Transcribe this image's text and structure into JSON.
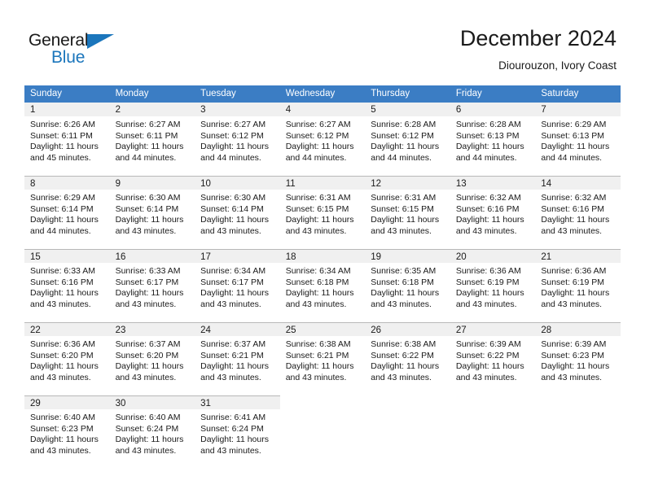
{
  "brand": {
    "name_top": "General",
    "name_bottom": "Blue",
    "accent_color": "#1b76bc"
  },
  "header": {
    "title": "December 2024",
    "subtitle": "Diourouzon, Ivory Coast"
  },
  "theme": {
    "header_row_bg": "#3b7dc4",
    "daynum_bg": "#f0f0f0",
    "text_color": "#1a1a1a",
    "grid_line": "#b8b8b8"
  },
  "weekday_headers": [
    "Sunday",
    "Monday",
    "Tuesday",
    "Wednesday",
    "Thursday",
    "Friday",
    "Saturday"
  ],
  "weeks": [
    [
      {
        "day": "1",
        "sunrise": "Sunrise: 6:26 AM",
        "sunset": "Sunset: 6:11 PM",
        "daylight1": "Daylight: 11 hours",
        "daylight2": "and 45 minutes."
      },
      {
        "day": "2",
        "sunrise": "Sunrise: 6:27 AM",
        "sunset": "Sunset: 6:11 PM",
        "daylight1": "Daylight: 11 hours",
        "daylight2": "and 44 minutes."
      },
      {
        "day": "3",
        "sunrise": "Sunrise: 6:27 AM",
        "sunset": "Sunset: 6:12 PM",
        "daylight1": "Daylight: 11 hours",
        "daylight2": "and 44 minutes."
      },
      {
        "day": "4",
        "sunrise": "Sunrise: 6:27 AM",
        "sunset": "Sunset: 6:12 PM",
        "daylight1": "Daylight: 11 hours",
        "daylight2": "and 44 minutes."
      },
      {
        "day": "5",
        "sunrise": "Sunrise: 6:28 AM",
        "sunset": "Sunset: 6:12 PM",
        "daylight1": "Daylight: 11 hours",
        "daylight2": "and 44 minutes."
      },
      {
        "day": "6",
        "sunrise": "Sunrise: 6:28 AM",
        "sunset": "Sunset: 6:13 PM",
        "daylight1": "Daylight: 11 hours",
        "daylight2": "and 44 minutes."
      },
      {
        "day": "7",
        "sunrise": "Sunrise: 6:29 AM",
        "sunset": "Sunset: 6:13 PM",
        "daylight1": "Daylight: 11 hours",
        "daylight2": "and 44 minutes."
      }
    ],
    [
      {
        "day": "8",
        "sunrise": "Sunrise: 6:29 AM",
        "sunset": "Sunset: 6:14 PM",
        "daylight1": "Daylight: 11 hours",
        "daylight2": "and 44 minutes."
      },
      {
        "day": "9",
        "sunrise": "Sunrise: 6:30 AM",
        "sunset": "Sunset: 6:14 PM",
        "daylight1": "Daylight: 11 hours",
        "daylight2": "and 43 minutes."
      },
      {
        "day": "10",
        "sunrise": "Sunrise: 6:30 AM",
        "sunset": "Sunset: 6:14 PM",
        "daylight1": "Daylight: 11 hours",
        "daylight2": "and 43 minutes."
      },
      {
        "day": "11",
        "sunrise": "Sunrise: 6:31 AM",
        "sunset": "Sunset: 6:15 PM",
        "daylight1": "Daylight: 11 hours",
        "daylight2": "and 43 minutes."
      },
      {
        "day": "12",
        "sunrise": "Sunrise: 6:31 AM",
        "sunset": "Sunset: 6:15 PM",
        "daylight1": "Daylight: 11 hours",
        "daylight2": "and 43 minutes."
      },
      {
        "day": "13",
        "sunrise": "Sunrise: 6:32 AM",
        "sunset": "Sunset: 6:16 PM",
        "daylight1": "Daylight: 11 hours",
        "daylight2": "and 43 minutes."
      },
      {
        "day": "14",
        "sunrise": "Sunrise: 6:32 AM",
        "sunset": "Sunset: 6:16 PM",
        "daylight1": "Daylight: 11 hours",
        "daylight2": "and 43 minutes."
      }
    ],
    [
      {
        "day": "15",
        "sunrise": "Sunrise: 6:33 AM",
        "sunset": "Sunset: 6:16 PM",
        "daylight1": "Daylight: 11 hours",
        "daylight2": "and 43 minutes."
      },
      {
        "day": "16",
        "sunrise": "Sunrise: 6:33 AM",
        "sunset": "Sunset: 6:17 PM",
        "daylight1": "Daylight: 11 hours",
        "daylight2": "and 43 minutes."
      },
      {
        "day": "17",
        "sunrise": "Sunrise: 6:34 AM",
        "sunset": "Sunset: 6:17 PM",
        "daylight1": "Daylight: 11 hours",
        "daylight2": "and 43 minutes."
      },
      {
        "day": "18",
        "sunrise": "Sunrise: 6:34 AM",
        "sunset": "Sunset: 6:18 PM",
        "daylight1": "Daylight: 11 hours",
        "daylight2": "and 43 minutes."
      },
      {
        "day": "19",
        "sunrise": "Sunrise: 6:35 AM",
        "sunset": "Sunset: 6:18 PM",
        "daylight1": "Daylight: 11 hours",
        "daylight2": "and 43 minutes."
      },
      {
        "day": "20",
        "sunrise": "Sunrise: 6:36 AM",
        "sunset": "Sunset: 6:19 PM",
        "daylight1": "Daylight: 11 hours",
        "daylight2": "and 43 minutes."
      },
      {
        "day": "21",
        "sunrise": "Sunrise: 6:36 AM",
        "sunset": "Sunset: 6:19 PM",
        "daylight1": "Daylight: 11 hours",
        "daylight2": "and 43 minutes."
      }
    ],
    [
      {
        "day": "22",
        "sunrise": "Sunrise: 6:36 AM",
        "sunset": "Sunset: 6:20 PM",
        "daylight1": "Daylight: 11 hours",
        "daylight2": "and 43 minutes."
      },
      {
        "day": "23",
        "sunrise": "Sunrise: 6:37 AM",
        "sunset": "Sunset: 6:20 PM",
        "daylight1": "Daylight: 11 hours",
        "daylight2": "and 43 minutes."
      },
      {
        "day": "24",
        "sunrise": "Sunrise: 6:37 AM",
        "sunset": "Sunset: 6:21 PM",
        "daylight1": "Daylight: 11 hours",
        "daylight2": "and 43 minutes."
      },
      {
        "day": "25",
        "sunrise": "Sunrise: 6:38 AM",
        "sunset": "Sunset: 6:21 PM",
        "daylight1": "Daylight: 11 hours",
        "daylight2": "and 43 minutes."
      },
      {
        "day": "26",
        "sunrise": "Sunrise: 6:38 AM",
        "sunset": "Sunset: 6:22 PM",
        "daylight1": "Daylight: 11 hours",
        "daylight2": "and 43 minutes."
      },
      {
        "day": "27",
        "sunrise": "Sunrise: 6:39 AM",
        "sunset": "Sunset: 6:22 PM",
        "daylight1": "Daylight: 11 hours",
        "daylight2": "and 43 minutes."
      },
      {
        "day": "28",
        "sunrise": "Sunrise: 6:39 AM",
        "sunset": "Sunset: 6:23 PM",
        "daylight1": "Daylight: 11 hours",
        "daylight2": "and 43 minutes."
      }
    ],
    [
      {
        "day": "29",
        "sunrise": "Sunrise: 6:40 AM",
        "sunset": "Sunset: 6:23 PM",
        "daylight1": "Daylight: 11 hours",
        "daylight2": "and 43 minutes."
      },
      {
        "day": "30",
        "sunrise": "Sunrise: 6:40 AM",
        "sunset": "Sunset: 6:24 PM",
        "daylight1": "Daylight: 11 hours",
        "daylight2": "and 43 minutes."
      },
      {
        "day": "31",
        "sunrise": "Sunrise: 6:41 AM",
        "sunset": "Sunset: 6:24 PM",
        "daylight1": "Daylight: 11 hours",
        "daylight2": "and 43 minutes."
      },
      {
        "day": "",
        "sunrise": "",
        "sunset": "",
        "daylight1": "",
        "daylight2": ""
      },
      {
        "day": "",
        "sunrise": "",
        "sunset": "",
        "daylight1": "",
        "daylight2": ""
      },
      {
        "day": "",
        "sunrise": "",
        "sunset": "",
        "daylight1": "",
        "daylight2": ""
      },
      {
        "day": "",
        "sunrise": "",
        "sunset": "",
        "daylight1": "",
        "daylight2": ""
      }
    ]
  ]
}
